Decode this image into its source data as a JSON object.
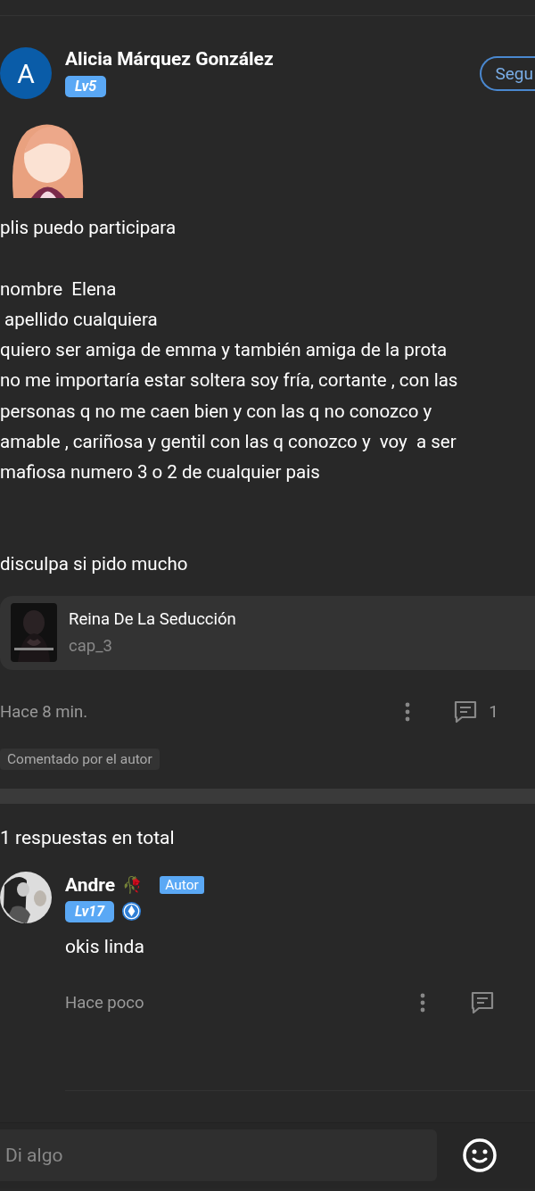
{
  "post": {
    "author": {
      "initial": "A",
      "name": "Alicia Márquez González",
      "level": "Lv5"
    },
    "follow_button": "Segu",
    "paragraphs": [
      [
        "plis puedo participara"
      ],
      [
        "nombre  Elena",
        " apellido cualquiera",
        "quiero ser amiga de emma y también amiga de la prota",
        "no me importaría estar soltera soy fría, cortante , con las",
        "personas q no me caen bien y con las q no conozco y",
        "amable , cariñosa y gentil con las q conozco y  voy  a ser",
        "mafiosa numero 3 o 2 de cualquier pais"
      ],
      [
        "disculpa si pido mucho"
      ]
    ],
    "story": {
      "title": "Reina De La Seducción",
      "chapter": "cap_3"
    },
    "time": "Hace 8 min.",
    "comment_count": "1",
    "chip": "Comentado por el autor"
  },
  "replies_header": "1 respuestas en total",
  "replies": [
    {
      "name": "Andre",
      "rose": "🥀",
      "author_tag": "Autor",
      "level": "Lv17",
      "verified": true,
      "text": "okis linda",
      "time": "Hace poco"
    }
  ],
  "composer": {
    "placeholder": "Di algo"
  }
}
